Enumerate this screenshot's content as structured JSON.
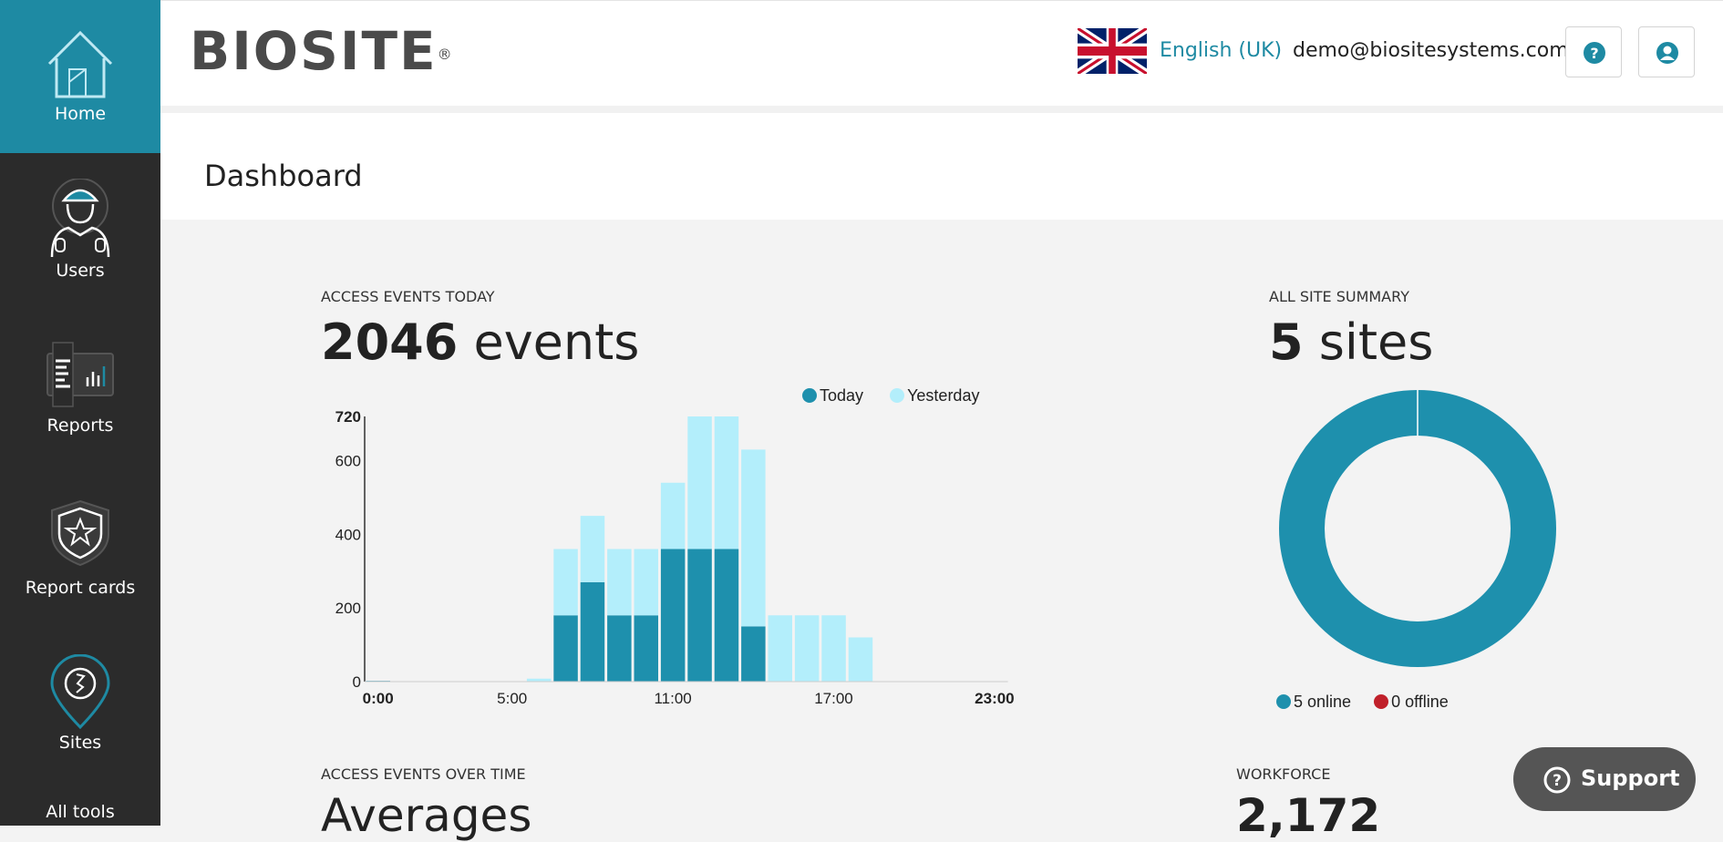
{
  "sidebar": {
    "items": [
      {
        "label": "Home",
        "icon": "house-icon",
        "active": true
      },
      {
        "label": "Users",
        "icon": "worker-icon"
      },
      {
        "label": "Reports",
        "icon": "report-icon"
      },
      {
        "label": "Report cards",
        "icon": "shield-star-icon"
      },
      {
        "label": "Sites",
        "icon": "map-pin-icon"
      },
      {
        "label": "All tools"
      }
    ]
  },
  "header": {
    "logo_text": "BIOSITE",
    "logo_mark": "®",
    "language": "English (UK)",
    "email": "demo@biositesystems.com",
    "help_icon": "help-icon",
    "account_icon": "account-icon"
  },
  "page": {
    "title": "Dashboard"
  },
  "colors": {
    "accent": "#1e8aa3",
    "today": "#1e90ad",
    "yesterday": "#b3eefb",
    "offline": "#c0202a",
    "sidebar": "#2b2b2b"
  },
  "access_today": {
    "label": "ACCESS EVENTS TODAY",
    "count": "2046",
    "unit": "events"
  },
  "site_summary": {
    "label": "ALL SITE SUMMARY",
    "count": "5",
    "unit": "sites",
    "online_label": "5 online",
    "offline_label": "0 offline"
  },
  "access_over_time": {
    "label": "ACCESS EVENTS OVER TIME",
    "value": "Averages"
  },
  "workforce": {
    "label": "WORKFORCE",
    "value": "2,172"
  },
  "support": {
    "label": "Support"
  },
  "chart_data": [
    {
      "type": "bar",
      "stacked": true,
      "categories": [
        "0:00",
        "1:00",
        "2:00",
        "3:00",
        "4:00",
        "5:00",
        "6:00",
        "7:00",
        "8:00",
        "9:00",
        "10:00",
        "11:00",
        "12:00",
        "13:00",
        "14:00",
        "15:00",
        "16:00",
        "17:00",
        "18:00",
        "19:00",
        "20:00",
        "21:00",
        "22:00",
        "23:00"
      ],
      "x_tick_labels": [
        "0:00",
        "5:00",
        "11:00",
        "17:00",
        "23:00"
      ],
      "series": [
        {
          "name": "Today",
          "values": [
            2,
            0,
            0,
            0,
            0,
            0,
            0,
            180,
            270,
            180,
            180,
            360,
            360,
            360,
            150,
            0,
            0,
            0,
            0,
            0,
            0,
            0,
            0,
            0
          ]
        },
        {
          "name": "Yesterday",
          "values": [
            0,
            0,
            0,
            0,
            0,
            0,
            8,
            180,
            180,
            180,
            180,
            180,
            360,
            360,
            480,
            180,
            180,
            180,
            120,
            0,
            0,
            0,
            0,
            0
          ]
        }
      ],
      "y_ticks": [
        0,
        200,
        400,
        600,
        720
      ],
      "ylim": [
        0,
        720
      ],
      "legend": "top"
    },
    {
      "type": "pie",
      "donut": true,
      "categories": [
        "online",
        "offline"
      ],
      "values": [
        5,
        0
      ],
      "legend": "bottom"
    }
  ]
}
